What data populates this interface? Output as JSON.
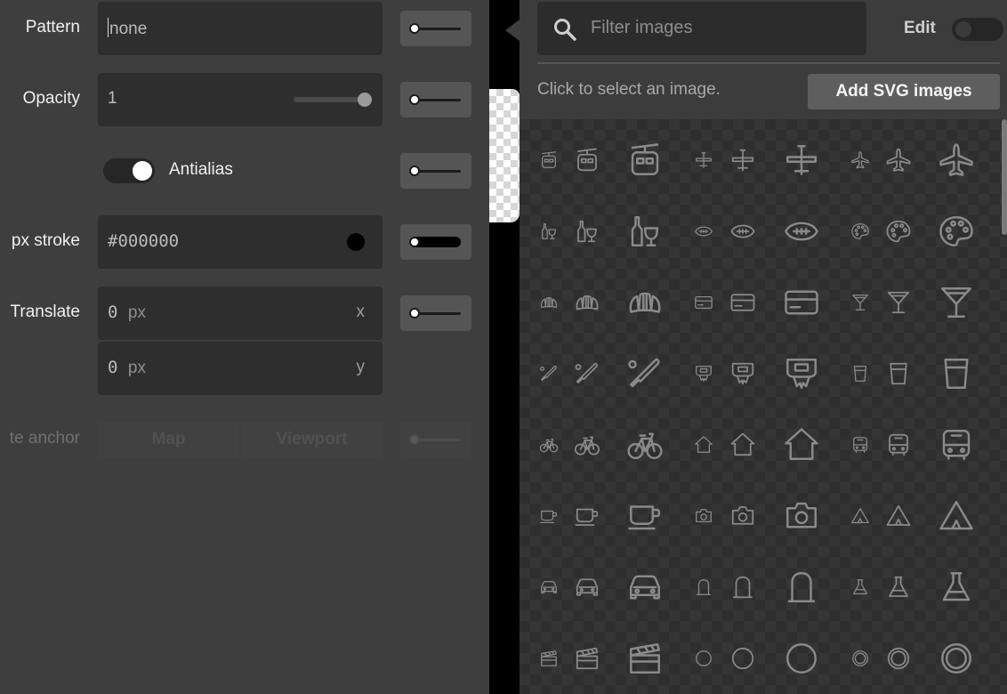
{
  "left_panel": {
    "pattern": {
      "label": "Pattern",
      "value": "none"
    },
    "opacity": {
      "label": "Opacity",
      "value": "1",
      "slider_value": 1
    },
    "antialias": {
      "label": "Antialias",
      "enabled": true
    },
    "stroke": {
      "label": "px stroke",
      "value": "#000000",
      "swatch_color": "#000000"
    },
    "translate": {
      "label": "Translate",
      "x": {
        "value": "0",
        "unit": "px",
        "axis": "x"
      },
      "y": {
        "value": "0",
        "unit": "px",
        "axis": "y"
      }
    },
    "anchor": {
      "label": "te anchor",
      "options": [
        "Map",
        "Viewport"
      ]
    }
  },
  "right_panel": {
    "search": {
      "placeholder": "Filter images"
    },
    "edit": {
      "label": "Edit",
      "enabled": false
    },
    "hint": "Click to select an image.",
    "add_button": "Add SVG images",
    "icon_rows": [
      [
        "aerialway",
        "airfield",
        "airport"
      ],
      [
        "alcohol-shop",
        "american-football",
        "art-gallery"
      ],
      [
        "bakery",
        "bank",
        "bar"
      ],
      [
        "baseball",
        "basketball",
        "beer"
      ],
      [
        "bicycle",
        "building",
        "bus"
      ],
      [
        "cafe",
        "camera",
        "campsite"
      ],
      [
        "car",
        "cemetery",
        "chemist"
      ],
      [
        "cinema",
        "circle",
        "circle-stroked"
      ]
    ]
  },
  "colors": {
    "panel_bg": "#3e3e3e",
    "field_bg": "#2e2e2e",
    "icon_stroke": "#8a8a8a"
  }
}
